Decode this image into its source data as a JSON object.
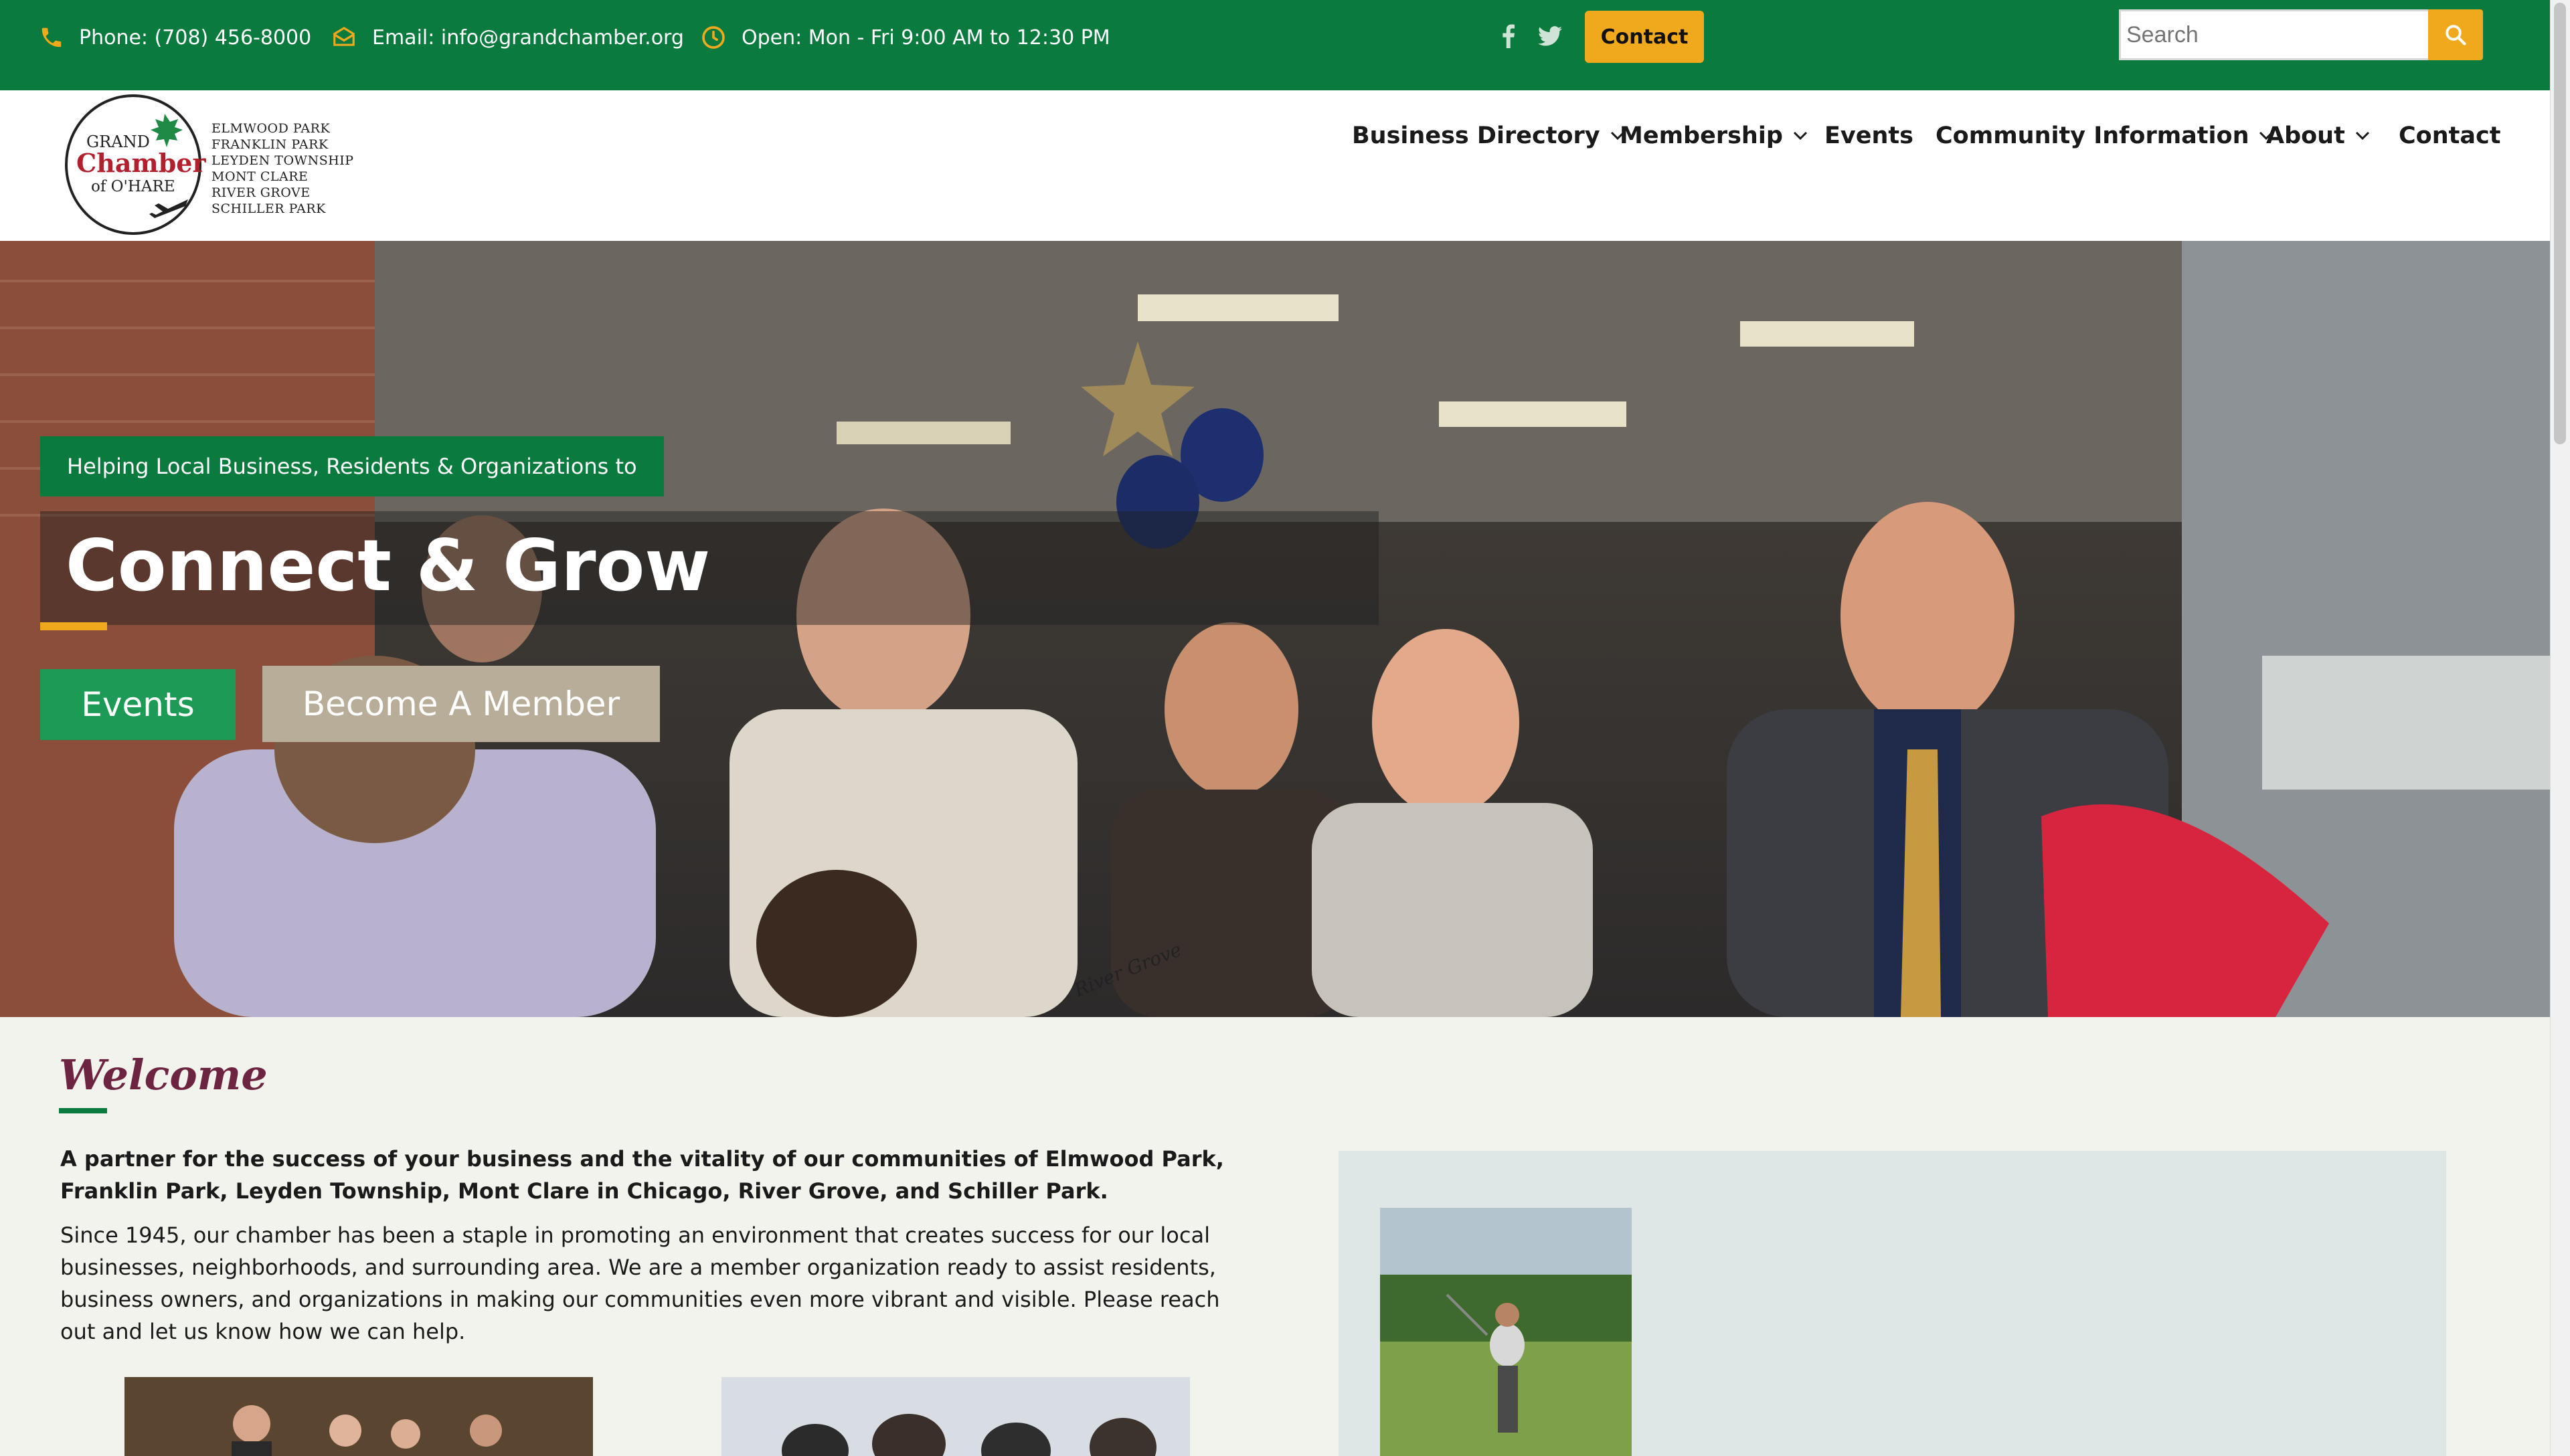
{
  "topbar": {
    "phone": "Phone: (708) 456-8000",
    "email": "Email: info@grandchamber.org",
    "hours": "Open: Mon - Fri 9:00 AM to 12:30 PM",
    "contact_label": "Contact",
    "search_placeholder": "Search"
  },
  "logo": {
    "line1": "GRAND",
    "line2": "Chamber",
    "line3": "of O'HARE",
    "towns": [
      "ELMWOOD PARK",
      "FRANKLIN PARK",
      "LEYDEN TOWNSHIP",
      "MONT CLARE",
      "RIVER GROVE",
      "SCHILLER PARK"
    ]
  },
  "nav": {
    "items": [
      {
        "label": "Business Directory",
        "dropdown": true
      },
      {
        "label": "Membership",
        "dropdown": true
      },
      {
        "label": "Events",
        "dropdown": false
      },
      {
        "label": "Community Information",
        "dropdown": true
      },
      {
        "label": "About",
        "dropdown": true
      },
      {
        "label": "Contact",
        "dropdown": false
      }
    ]
  },
  "hero": {
    "tagline": "Helping Local Business, Residents & Organizations to",
    "headline": "Connect & Grow",
    "events_label": "Events",
    "member_label": "Become A Member",
    "ribbon_text": "River Grove"
  },
  "welcome": {
    "title": "Welcome",
    "lead": "A partner for the success of your business and the vitality of our communities of Elmwood Park, Franklin Park, Leyden Township, Mont Clare in Chicago, River Grove, and Schiller Park.",
    "body": "Since 1945, our chamber has been a staple in promoting an environment that creates success for our local businesses, neighborhoods, and surrounding area.  We are a member organization ready to assist residents, business owners, and organizations in making our communities even more vibrant and visible.  Please reach out and let us know how we can help."
  },
  "colors": {
    "brand_green": "#0a7a3f",
    "accent_gold": "#f0a81c",
    "heading_maroon": "#6d2440",
    "member_button": "#b7ad99"
  }
}
